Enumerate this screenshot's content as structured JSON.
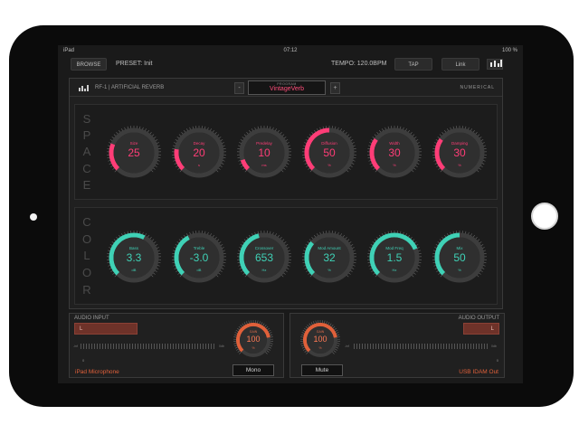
{
  "status_bar": {
    "carrier": "iPad",
    "time": "07:12",
    "battery": "100 %"
  },
  "toolbar": {
    "browse_label": "BROWSE",
    "preset": "PRESET: Init",
    "tempo": "TEMPO: 120.0BPM",
    "tap_label": "TAP",
    "link_label": "Link"
  },
  "plugin": {
    "name": "RF-1 | ARTIFICIAL REVERB",
    "prev_label": "-",
    "next_label": "+",
    "program_label": "PROGRAM",
    "program_value": "VintageVerb",
    "mode_label": "NUMERICAL"
  },
  "space": {
    "title_letters": [
      "S",
      "P",
      "A",
      "C",
      "E"
    ],
    "accent": "#ff3d77",
    "knobs": [
      {
        "label": "Size",
        "value": "25",
        "unit": "",
        "level": 0.25
      },
      {
        "label": "Decay",
        "value": "20",
        "unit": "s",
        "level": 0.2
      },
      {
        "label": "Predelay",
        "value": "10",
        "unit": "ms",
        "level": 0.1
      },
      {
        "label": "Diffusion",
        "value": "50",
        "unit": "%",
        "level": 0.5
      },
      {
        "label": "Width",
        "value": "30",
        "unit": "%",
        "level": 0.3
      },
      {
        "label": "Damping",
        "value": "30",
        "unit": "%",
        "level": 0.3
      }
    ]
  },
  "color": {
    "title_letters": [
      "C",
      "O",
      "L",
      "O",
      "R"
    ],
    "accent": "#3fd1b6",
    "knobs": [
      {
        "label": "Bass",
        "value": "3.3",
        "unit": "dB",
        "level": 0.6
      },
      {
        "label": "Treble",
        "value": "-3.0",
        "unit": "dB",
        "level": 0.4
      },
      {
        "label": "Crossover",
        "value": "653",
        "unit": "Hz",
        "level": 0.45
      },
      {
        "label": "Mod Amount",
        "value": "32",
        "unit": "%",
        "level": 0.32
      },
      {
        "label": "Mod Freq",
        "value": "1.5",
        "unit": "Hz",
        "level": 0.75
      },
      {
        "label": "Mix",
        "value": "50",
        "unit": "%",
        "level": 0.5
      }
    ]
  },
  "input": {
    "title": "AUDIO INPUT",
    "channel": "L",
    "zero": "0",
    "meter_min": "-inf",
    "meter_max": "0db",
    "gain_label": "GAIN",
    "gain_value": "100",
    "gain_unit": "%",
    "gain_level": 0.8,
    "device": "iPad Microphone",
    "button_label": "Mono"
  },
  "output": {
    "title": "AUDIO OUTPUT",
    "channel": "L",
    "zero": "0",
    "meter_min": "-inf",
    "meter_max": "0db",
    "gain_label": "GAIN",
    "gain_value": "100",
    "gain_unit": "%",
    "gain_level": 0.8,
    "device": "USB IDAM Out",
    "button_label": "Mute"
  },
  "colors": {
    "io_accent": "#e0603a"
  }
}
